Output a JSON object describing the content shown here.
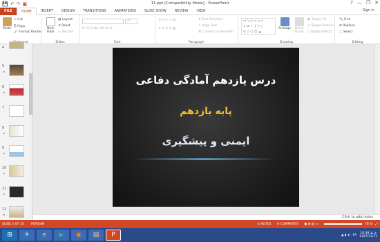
{
  "window": {
    "title": "11.ppt [Compatibility Mode] - PowerPoint",
    "controls": [
      "?",
      "—",
      "❐",
      "✕"
    ]
  },
  "qat": [
    "💾",
    "↶",
    "↷",
    "▣"
  ],
  "tabs": [
    "FILE",
    "HOME",
    "INSERT",
    "DESIGN",
    "TRANSITIONS",
    "ANIMATIONS",
    "SLIDE SHOW",
    "REVIEW",
    "VIEW"
  ],
  "user": "Sign in",
  "ribbon": {
    "clipboard": {
      "paste": "Paste",
      "cut": "Cut",
      "copy": "Copy",
      "format_painter": "Format Painter",
      "label": "Clipboard"
    },
    "slides": {
      "new_slide": "New Slide",
      "layout": "Layout",
      "reset": "Reset",
      "section": "Section",
      "label": "Slides"
    },
    "font": {
      "size": "27",
      "label": "Font"
    },
    "paragraph": {
      "text_direction": "Text Direction",
      "align_text": "Align Text",
      "smartart": "Convert to SmartArt",
      "label": "Paragraph"
    },
    "drawing": {
      "arrange": "Arrange",
      "quick_styles": "Quick Styles",
      "shape_fill": "Shape Fill",
      "shape_outline": "Shape Outline",
      "shape_effects": "Shape Effects",
      "label": "Drawing"
    },
    "editing": {
      "find": "Find",
      "replace": "Replace",
      "select": "Select",
      "label": "Editing"
    }
  },
  "thumbnails": [
    "4",
    "5",
    "6",
    "7",
    "8",
    "9",
    "10",
    "11",
    "12"
  ],
  "slide": {
    "line1": "درس یازدهم آمادگی دفاعی",
    "line2": "پایه یازدهم",
    "line3": "ایمنی و پیشگیری"
  },
  "notes_placeholder": "Click to add notes",
  "status": {
    "slide": "SLIDE 2 OF 24",
    "language": "PERSIAN",
    "notes": "NOTES",
    "comments": "COMMENTS",
    "zoom": "78 %"
  },
  "taskbar": {
    "time": "10:38 ق.ظ",
    "date": "1397/11/11",
    "lang": "FA"
  },
  "colors": {
    "accent": "#d24726",
    "slide_title": "#ffffff",
    "slide_subtitle": "#f2c12e",
    "slide_line3": "#dde8f5"
  }
}
